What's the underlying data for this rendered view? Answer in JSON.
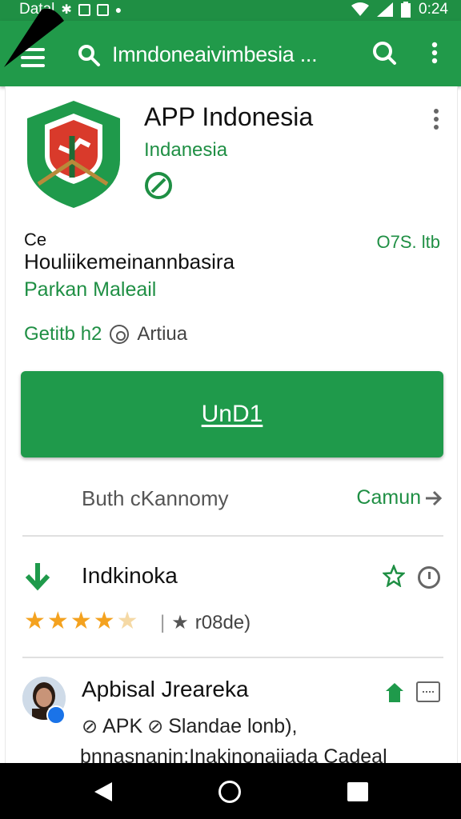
{
  "status_bar": {
    "carrier": "Datal",
    "time": "0:24"
  },
  "app_bar": {
    "title": "Imndoneaivimbesia ..."
  },
  "app": {
    "name": "APP Indonesia",
    "developer": "Indanesia",
    "tag": "Ce",
    "size": "O7S. ltb",
    "description": "Houliikemeinannbasira",
    "category": "Parkan Maleail",
    "downloads": "Getitb h2",
    "rating_label": "Artiua"
  },
  "install_button": {
    "label": "UnD1"
  },
  "info_row": {
    "left": "Buth cKannomy",
    "right": "Camun"
  },
  "ratings_section": {
    "title": "Indkinoka",
    "stars": 4,
    "stars_max": 5,
    "review_meta": "r08de)"
  },
  "review": {
    "title": "Apbisal Jreareka",
    "line1_a": "APK",
    "line1_b": "Slandae lonb),",
    "line2": "bnnasnanin:Inakinonaiiada Cadeal"
  },
  "colors": {
    "primary": "#219a4a",
    "accent_text": "#1f8f44",
    "star": "#f4a21f"
  }
}
